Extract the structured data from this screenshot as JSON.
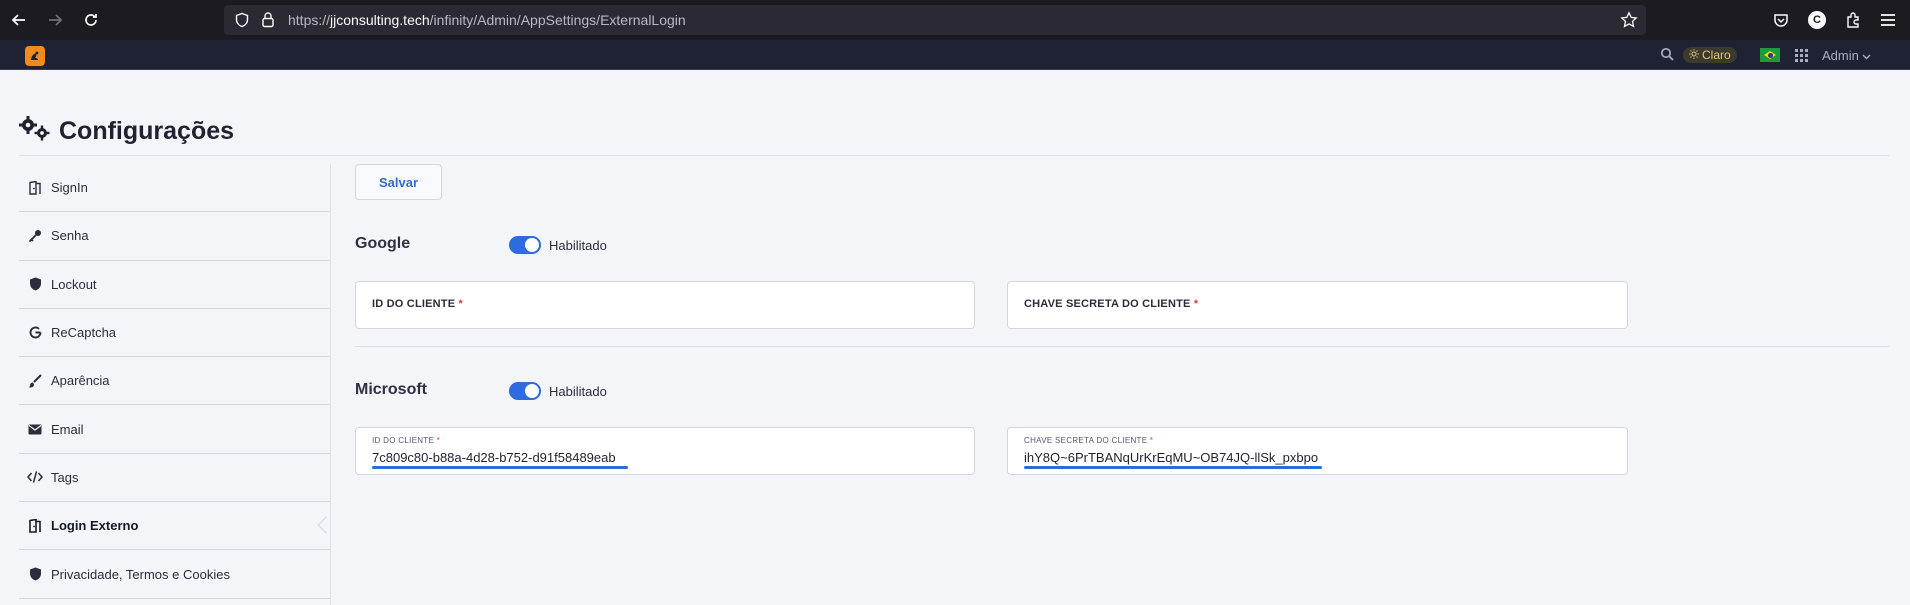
{
  "browser": {
    "url_prefix": "https://",
    "url_host": "jjconsulting.tech",
    "url_path": "/infinity/Admin/AppSettings/ExternalLogin",
    "profile_initial": "C"
  },
  "topbar": {
    "theme_label": "Claro",
    "user_label": "Admin"
  },
  "page": {
    "title": "Configurações",
    "save_label": "Salvar"
  },
  "sidebar": {
    "items": [
      {
        "label": "SignIn",
        "icon": "door-icon"
      },
      {
        "label": "Senha",
        "icon": "key-icon"
      },
      {
        "label": "Lockout",
        "icon": "shield-icon"
      },
      {
        "label": "ReCaptcha",
        "icon": "google-icon"
      },
      {
        "label": "Aparência",
        "icon": "brush-icon"
      },
      {
        "label": "Email",
        "icon": "envelope-icon"
      },
      {
        "label": "Tags",
        "icon": "code-icon"
      },
      {
        "label": "Login Externo",
        "icon": "door-icon"
      },
      {
        "label": "Privacidade, Termos e Cookies",
        "icon": "shield-icon"
      }
    ],
    "active_index": 7
  },
  "providers": {
    "google": {
      "name": "Google",
      "toggle_label": "Habilitado",
      "enabled": true,
      "client_id_label": "ID DO CLIENTE",
      "client_id_value": "",
      "secret_label": "CHAVE SECRETA DO CLIENTE",
      "secret_value": ""
    },
    "microsoft": {
      "name": "Microsoft",
      "toggle_label": "Habilitado",
      "enabled": true,
      "client_id_label": "ID DO CLIENTE",
      "client_id_value": "7c809c80-b88a-4d28-b752-d91f58489eab",
      "secret_label": "CHAVE SECRETA DO CLIENTE",
      "secret_value": "ihY8Q~6PrTBANqUrKrEqMU~OB74JQ-llSk_pxbpo"
    }
  },
  "required_mark": "*",
  "colors": {
    "accent": "#2d6bdf",
    "logo": "#f28a1c",
    "required": "#e03a3a",
    "topbar": "#1f2233"
  }
}
